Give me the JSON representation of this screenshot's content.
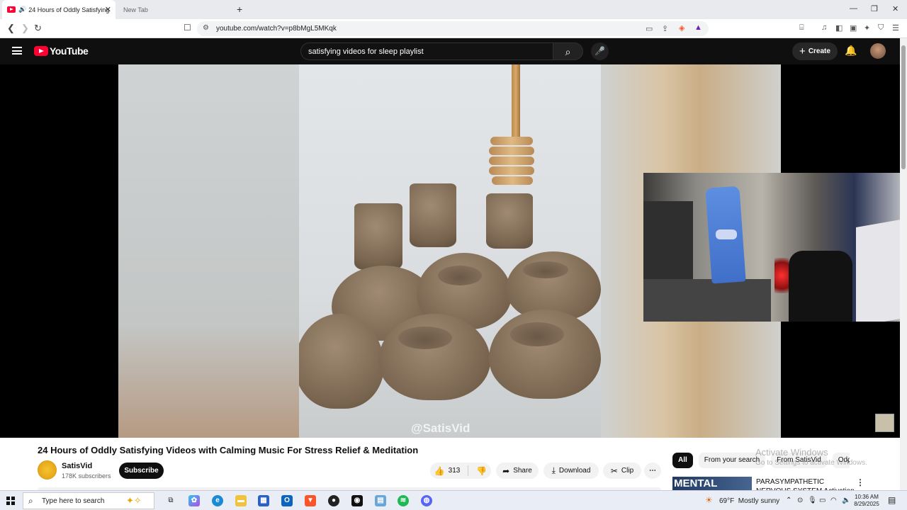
{
  "browser": {
    "active_tab_title": "24 Hours of Oddly Satisfying",
    "inactive_tab_title": "New Tab",
    "url": "youtube.com/watch?v=p8bMgL5MKqk"
  },
  "youtube": {
    "logo_text": "YouTube",
    "search_value": "satisfying videos for sleep playlist",
    "create_label": "Create"
  },
  "video": {
    "watermark": "@SatisVid",
    "title": "24 Hours of Oddly Satisfying Videos with Calming Music For Stress Relief & Meditation"
  },
  "channel": {
    "name": "SatisVid",
    "subscribers": "178K subscribers",
    "subscribe_label": "Subscribe"
  },
  "actions": {
    "likes": "313",
    "share_label": "Share",
    "download_label": "Download",
    "clip_label": "Clip"
  },
  "chips": [
    "All",
    "From your search",
    "From SatisVid",
    "Odd"
  ],
  "watermark_overlay": {
    "line1": "Activate Windows",
    "line2": "Go to Settings to activate Windows."
  },
  "recommendation": {
    "thumb_text": "MENTAL",
    "title": "PARASYMPATHETIC NERVOUS SYSTEM Activation | Tibetan"
  },
  "taskbar": {
    "search_placeholder": "Type here to search",
    "weather": "69°F  Mostly sunny",
    "time": "10:36 AM",
    "date": "8/29/2025"
  },
  "colors": {
    "yt_red": "#ff0033",
    "dark_header": "#0f0f0f"
  }
}
